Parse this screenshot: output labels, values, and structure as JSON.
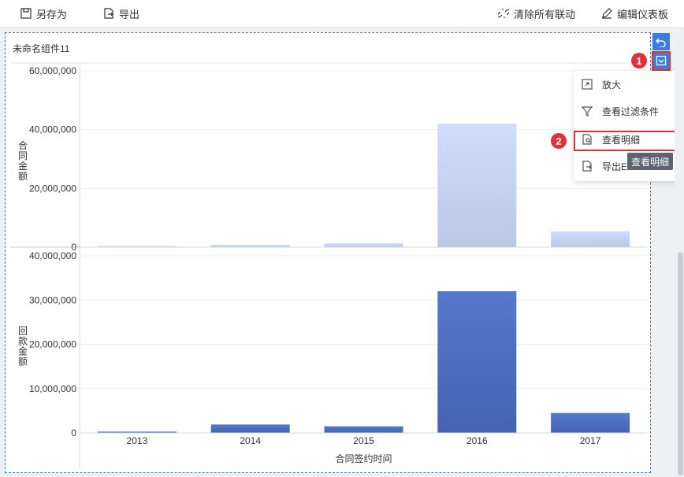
{
  "toolbar": {
    "save_as": "另存为",
    "export": "导出",
    "clear_links": "清除所有联动",
    "edit_dashboard": "编辑仪表板"
  },
  "widget": {
    "title": "未命名组件11"
  },
  "menu": {
    "items": [
      {
        "label": "放大",
        "icon": "zoom-icon"
      },
      {
        "label": "查看过滤条件",
        "icon": "filter-icon"
      },
      {
        "label": "查看明细",
        "icon": "detail-icon"
      },
      {
        "label": "导出Excel",
        "icon": "export-icon"
      }
    ]
  },
  "tooltip": "查看明细",
  "steps": [
    "1",
    "2"
  ],
  "colors": {
    "accent": "#3b7ddd",
    "highlight": "#e0303a",
    "bar_top": "#c9d8f8",
    "bar_bottom": "#4a6bbd"
  },
  "chart_data": [
    {
      "type": "bar",
      "ylabel": "合同金额",
      "categories": [
        "2013",
        "2014",
        "2015",
        "2016",
        "2017"
      ],
      "values": [
        400000,
        800000,
        1300000,
        42000000,
        5400000
      ],
      "ylim": [
        0,
        60000000
      ],
      "yticks": [
        "60,000,000",
        "40,000,000",
        "20,000,000",
        "0"
      ],
      "ytick_values": [
        60000000,
        40000000,
        20000000,
        0
      ]
    },
    {
      "type": "bar",
      "ylabel": "回款金额",
      "xlabel": "合同签约时间",
      "categories": [
        "2013",
        "2014",
        "2015",
        "2016",
        "2017"
      ],
      "values": [
        300000,
        1900000,
        1500000,
        32000000,
        4500000
      ],
      "ylim": [
        0,
        40000000
      ],
      "yticks": [
        "40,000,000",
        "30,000,000",
        "20,000,000",
        "10,000,000",
        "0"
      ],
      "ytick_values": [
        40000000,
        30000000,
        20000000,
        10000000,
        0
      ]
    }
  ]
}
